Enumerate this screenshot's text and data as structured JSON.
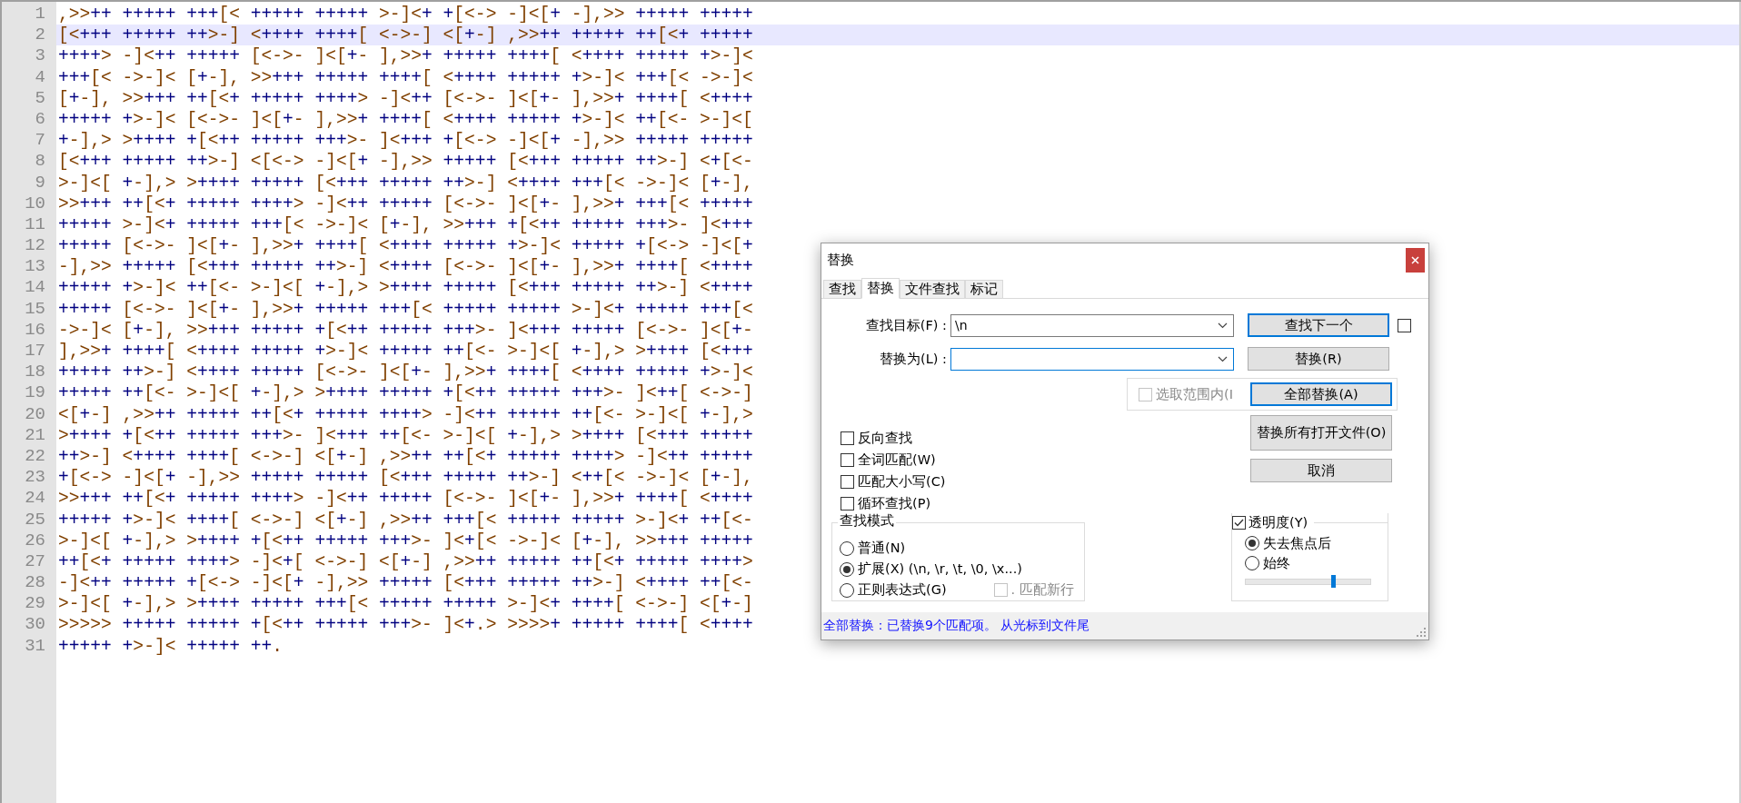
{
  "editor": {
    "lines": [
      {
        "number": "1",
        "text": ",>>++ +++++ +++[< +++++ +++++ >-]<+ +[<-> -]<[+ -],>> +++++ +++++",
        "current": false
      },
      {
        "number": "2",
        "text": "[<+++ +++++ ++>-] <++++ ++++[ <->-] <[+-] ,>>++ +++++ ++[<+ +++++",
        "current": true
      },
      {
        "number": "3",
        "text": "++++> -]<++ +++++ [<->- ]<[+- ],>>+ +++++ ++++[ <++++ +++++ +>-]<",
        "current": false
      },
      {
        "number": "4",
        "text": "+++[< ->-]< [+-], >>+++ +++++ ++++[ <++++ +++++ +>-]< +++[< ->-]<",
        "current": false
      },
      {
        "number": "5",
        "text": "[+-], >>+++ ++[<+ +++++ ++++> -]<++ [<->- ]<[+- ],>>+ ++++[ <++++",
        "current": false
      },
      {
        "number": "6",
        "text": "+++++ +>-]< [<->- ]<[+- ],>>+ ++++[ <++++ +++++ +>-]< ++[<- >-]<[",
        "current": false
      },
      {
        "number": "7",
        "text": "+-],> >++++ +[<++ +++++ +++>- ]<+++ +[<-> -]<[+ -],>> +++++ +++++",
        "current": false
      },
      {
        "number": "8",
        "text": "[<+++ +++++ ++>-] <[<-> -]<[+ -],>> +++++ [<+++ +++++ ++>-] <+[<-",
        "current": false
      },
      {
        "number": "9",
        "text": ">-]<[ +-],> >++++ +++++ [<+++ +++++ ++>-] <++++ +++[< ->-]< [+-],",
        "current": false
      },
      {
        "number": "10",
        "text": ">>+++ ++[<+ +++++ ++++> -]<++ +++++ [<->- ]<[+- ],>>+ +++[< +++++",
        "current": false
      },
      {
        "number": "11",
        "text": "+++++ >-]<+ +++++ +++[< ->-]< [+-], >>+++ +[<++ +++++ +++>- ]<+++",
        "current": false
      },
      {
        "number": "12",
        "text": "+++++ [<->- ]<[+- ],>>+ ++++[ <++++ +++++ +>-]< +++++ +[<-> -]<[+",
        "current": false
      },
      {
        "number": "13",
        "text": "-],>> +++++ [<+++ +++++ ++>-] <++++ [<->- ]<[+- ],>>+ ++++[ <++++",
        "current": false
      },
      {
        "number": "14",
        "text": "+++++ +>-]< ++[<- >-]<[ +-],> >++++ +++++ [<+++ +++++ ++>-] <++++",
        "current": false
      },
      {
        "number": "15",
        "text": "+++++ [<->- ]<[+- ],>>+ +++++ +++[< +++++ +++++ >-]<+ +++++ +++[<",
        "current": false
      },
      {
        "number": "16",
        "text": "->-]< [+-], >>+++ +++++ +[<++ +++++ +++>- ]<+++ +++++ [<->- ]<[+-",
        "current": false
      },
      {
        "number": "17",
        "text": "],>>+ ++++[ <++++ +++++ +>-]< +++++ ++[<- >-]<[ +-],> >++++ [<+++",
        "current": false
      },
      {
        "number": "18",
        "text": "+++++ ++>-] <++++ +++++ [<->- ]<[+- ],>>+ ++++[ <++++ +++++ +>-]<",
        "current": false
      },
      {
        "number": "19",
        "text": "+++++ ++[<- >-]<[ +-],> >++++ +++++ +[<++ +++++ +++>- ]<++[ <->-]",
        "current": false
      },
      {
        "number": "20",
        "text": "<[+-] ,>>++ +++++ ++[<+ +++++ ++++> -]<++ +++++ ++[<- >-]<[ +-],>",
        "current": false
      },
      {
        "number": "21",
        "text": ">++++ +[<++ +++++ +++>- ]<+++ ++[<- >-]<[ +-],> >++++ [<+++ +++++",
        "current": false
      },
      {
        "number": "22",
        "text": "++>-] <++++ ++++[ <->-] <[+-] ,>>++ ++[<+ +++++ ++++> -]<++ +++++",
        "current": false
      },
      {
        "number": "23",
        "text": "+[<-> -]<[+ -],>> +++++ +++++ [<+++ +++++ ++>-] <++[< ->-]< [+-],",
        "current": false
      },
      {
        "number": "24",
        "text": ">>+++ ++[<+ +++++ ++++> -]<++ +++++ [<->- ]<[+- ],>>+ ++++[ <++++",
        "current": false
      },
      {
        "number": "25",
        "text": "+++++ +>-]< ++++[ <->-] <[+-] ,>>++ +++[< +++++ +++++ >-]<+ ++[<-",
        "current": false
      },
      {
        "number": "26",
        "text": ">-]<[ +-],> >++++ +[<++ +++++ +++>- ]<+[< ->-]< [+-], >>+++ +++++",
        "current": false
      },
      {
        "number": "27",
        "text": "++[<+ +++++ ++++> -]<+[ <->-] <[+-] ,>>++ +++++ ++[<+ +++++ ++++>",
        "current": false
      },
      {
        "number": "28",
        "text": "-]<++ +++++ +[<-> -]<[+ -],>> +++++ [<+++ +++++ ++>-] <++++ ++[<-",
        "current": false
      },
      {
        "number": "29",
        "text": ">-]<[ +-],> >++++ +++++ +++[< +++++ +++++ >-]<+ ++++[ <->-] <[+-]",
        "current": false
      },
      {
        "number": "30",
        "text": ">>>>> +++++ +++++ +[<++ +++++ +++>- ]<+.> >>>>+ +++++ ++++[ <++++",
        "current": false
      },
      {
        "number": "31",
        "text": "+++++ +>-]< +++++ ++.",
        "current": false
      }
    ]
  },
  "dialog": {
    "title": "替换",
    "tabs": [
      {
        "label": "查找",
        "selected": false
      },
      {
        "label": "替换",
        "selected": true
      },
      {
        "label": "文件查找",
        "selected": false
      },
      {
        "label": "标记",
        "selected": false
      }
    ],
    "fields": [
      {
        "label": "查找目标(F) :",
        "value": "\\n"
      },
      {
        "label": "替换为(L) :"
      }
    ],
    "buttons": [
      {
        "label": "查找下一个",
        "focused": true
      },
      {
        "label": "替换(R)",
        "focused": false
      },
      {
        "label": "全部替换(A)",
        "focused": true
      },
      {
        "label": "替换所有打开文件(O)",
        "focused": false
      },
      {
        "label": "取消",
        "focused": false
      }
    ],
    "side_checkbox": {
      "checked": false
    },
    "in_selection": {
      "label": "选取范围内(I",
      "checked": false,
      "disabled": true
    },
    "options": [
      {
        "label": "反向查找",
        "checked": false
      },
      {
        "label": "全词匹配(W)",
        "checked": false
      },
      {
        "label": "匹配大小写(C)",
        "checked": false
      },
      {
        "label": "循环查找(P)",
        "checked": false
      }
    ],
    "search_mode": {
      "title": "查找模式",
      "options": [
        {
          "label": "普通(N)",
          "selected": false
        },
        {
          "label": "扩展(X) (\\n, \\r, \\t, \\0, \\x...)",
          "selected": true
        },
        {
          "label": "正则表达式(G)",
          "selected": false
        }
      ],
      "dot_newline": {
        "label": ". 匹配新行",
        "checked": false,
        "disabled": true
      }
    },
    "transparency": {
      "label": "透明度(Y)",
      "checked": true,
      "options": [
        {
          "label": "失去焦点后",
          "selected": true
        },
        {
          "label": "始终",
          "selected": false
        }
      ],
      "level": 0.7
    },
    "status": "全部替换：已替换9个匹配项。 从光标到文件尾"
  }
}
